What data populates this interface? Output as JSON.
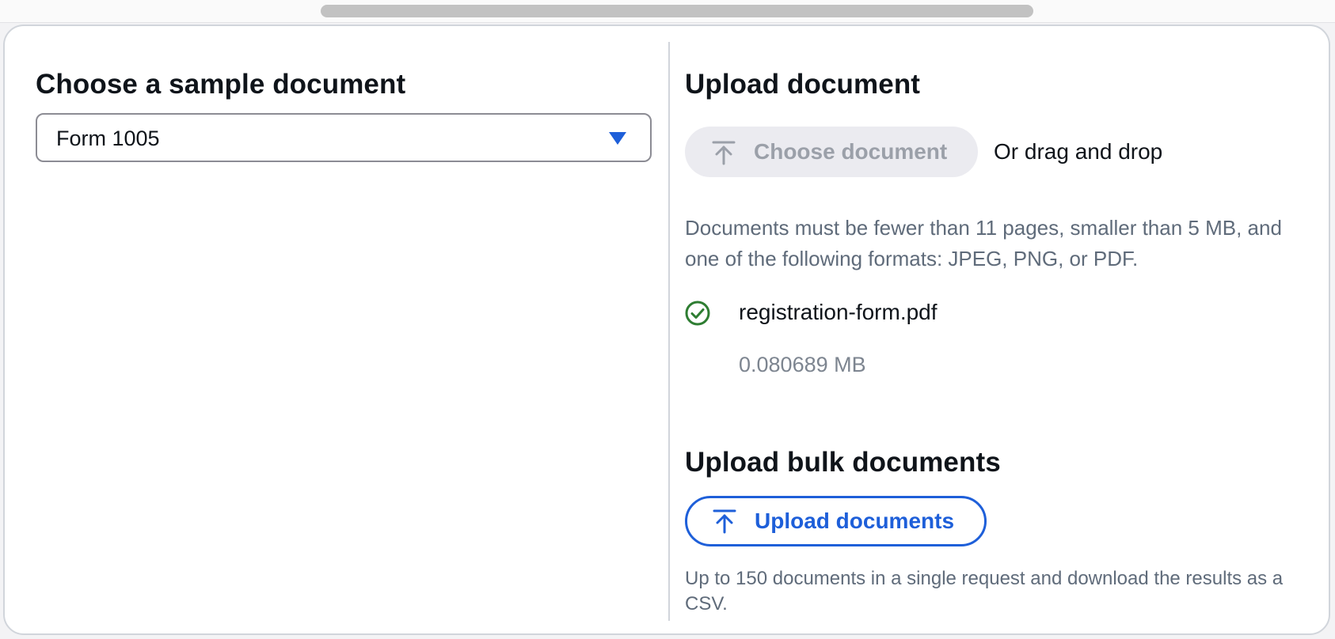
{
  "left": {
    "heading": "Choose a sample document",
    "select_value": "Form 1005"
  },
  "upload": {
    "heading": "Upload document",
    "choose_label": "Choose document",
    "drag_text": "Or drag and drop",
    "constraint_text": "Documents must be fewer than 11 pages, smaller than 5 MB, and one of the following formats: JPEG, PNG, or PDF.",
    "file": {
      "name": "registration-form.pdf",
      "size": "0.080689 MB",
      "status_icon": "success-check-icon"
    }
  },
  "bulk": {
    "heading": "Upload bulk documents",
    "button_label": "Upload documents",
    "description": "Up to 150 documents in a single request and download the results as a CSV."
  },
  "colors": {
    "accent": "#1e5fd9",
    "success": "#2e7d32",
    "muted_text": "#5f6b7a",
    "disabled_bg": "#ebebf0"
  }
}
